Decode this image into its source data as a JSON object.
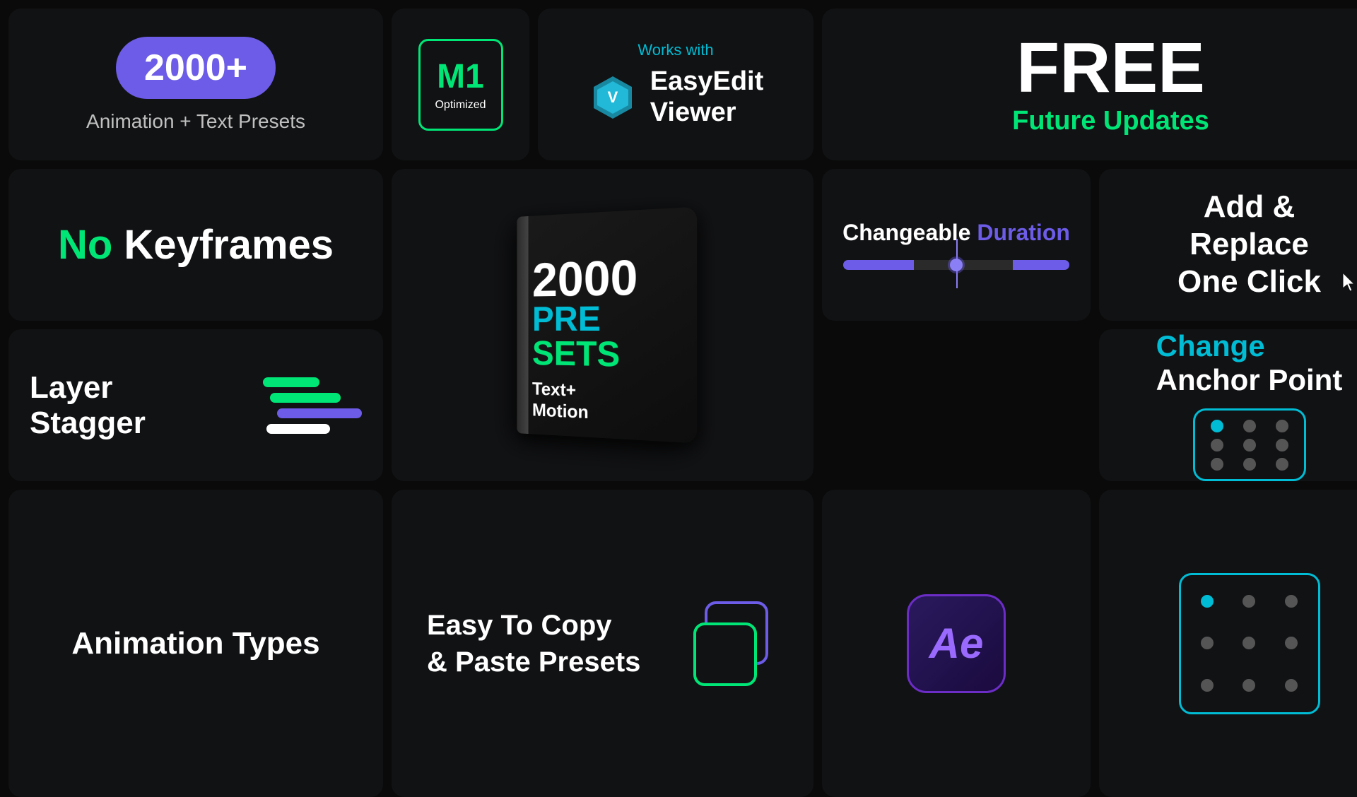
{
  "cells": {
    "c1": {
      "badge": "2000+",
      "label": "Animation + Text Presets"
    },
    "c2": {
      "m1": "M1",
      "optimized": "Optimized"
    },
    "c3": {
      "worksWith": "Works with",
      "name": "EasyEdit\nViewer"
    },
    "c4": {
      "free": "FREE",
      "future": "Future Updates"
    },
    "c5": {
      "no": "No",
      "keyframes": " Keyframes"
    },
    "c6": {
      "number": "2000",
      "pre": "PRE",
      "sets": "SETS",
      "subtitle": "Text+\nMotion"
    },
    "c7": {
      "changeable": "Changeable ",
      "duration": "Duration"
    },
    "c8": {
      "label": "Add &\nReplace\nOne Click"
    },
    "c9": {
      "label": "Layer Stagger"
    },
    "c11": {
      "change": "Change",
      "anchor": "Anchor Point"
    },
    "c12": {
      "label": "Animation Types"
    },
    "c13": {
      "label": "Easy To Copy\n& Paste Presets"
    },
    "c14": {
      "ae": "Ae"
    }
  }
}
